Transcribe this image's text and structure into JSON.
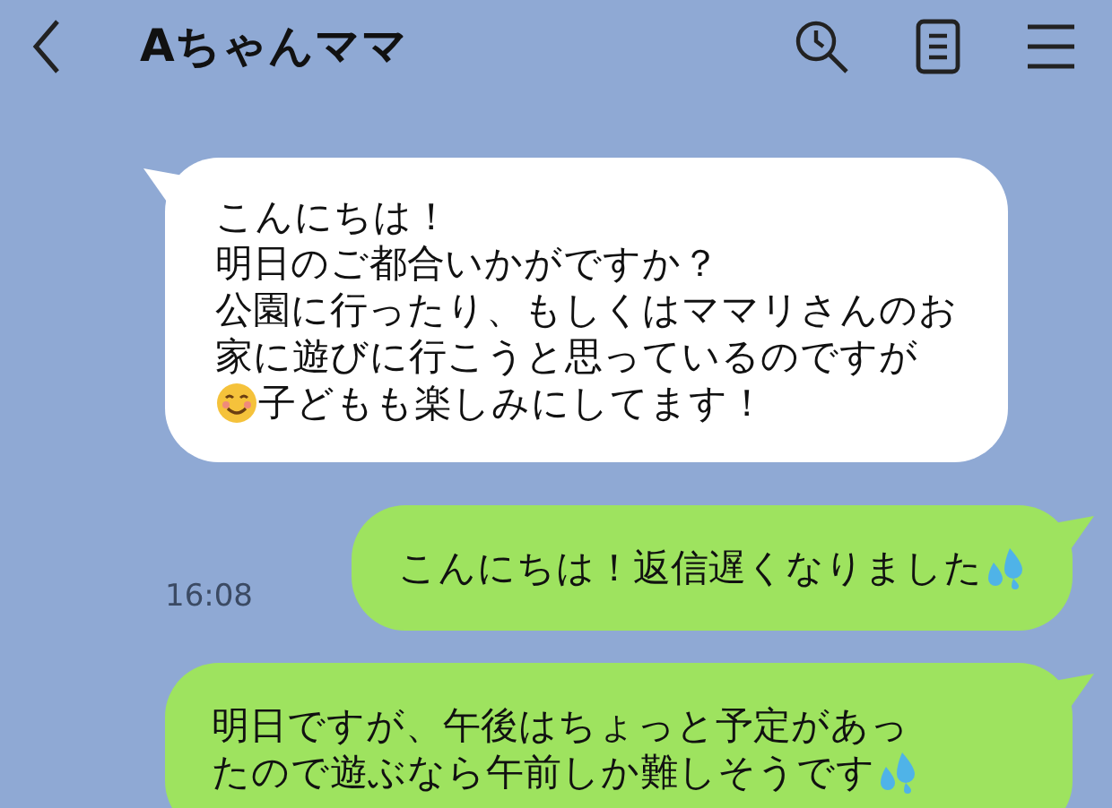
{
  "header": {
    "title": "Aちゃんママ"
  },
  "messages": [
    {
      "kind": "incoming",
      "lines": [
        [
          {
            "kind": "text",
            "text": "こんにちは！"
          }
        ],
        [
          {
            "kind": "text",
            "text": "明日のご都合いかがですか？"
          }
        ],
        [
          {
            "kind": "text",
            "text": "公園に行ったり、もしくはママリさんのお"
          }
        ],
        [
          {
            "kind": "text",
            "text": "家に遊びに行こうと思っているのですが"
          }
        ],
        [
          {
            "kind": "smile"
          },
          {
            "kind": "text",
            "text": "子どもも楽しみにしてます！"
          }
        ]
      ]
    },
    {
      "kind": "outgoing",
      "time": "16:08",
      "lines": [
        [
          {
            "kind": "text",
            "text": "こんにちは！返信遅くなりました"
          },
          {
            "kind": "sweat"
          }
        ]
      ]
    },
    {
      "kind": "outgoing",
      "lines": [
        [
          {
            "kind": "text",
            "text": "明日ですが、午後はちょっと予定があっ"
          }
        ],
        [
          {
            "kind": "text",
            "text": "たので遊ぶなら午前しか難しそうです"
          },
          {
            "kind": "sweat"
          }
        ]
      ]
    }
  ]
}
